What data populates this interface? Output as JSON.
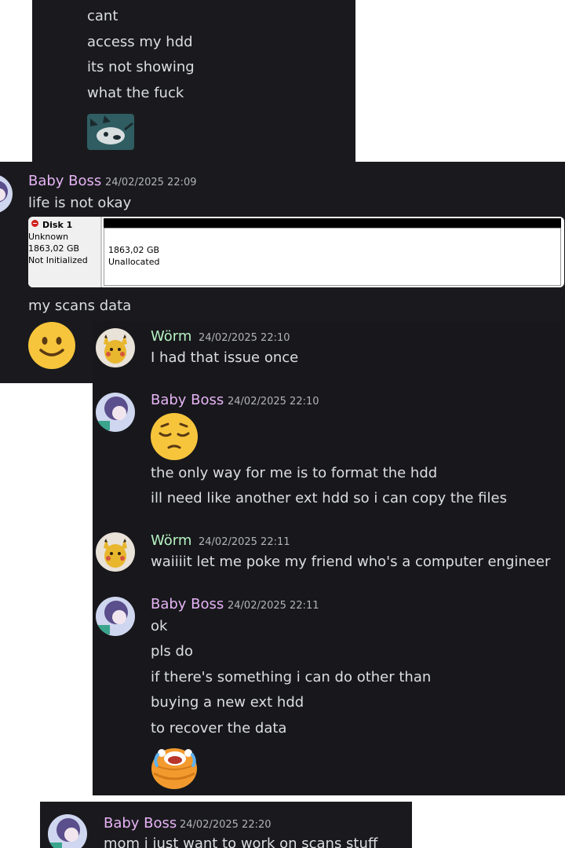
{
  "top_messages": [
    "cant",
    "access my hdd",
    "its not showing",
    "what the fuck"
  ],
  "baby_boss_1": {
    "username": "Baby Boss",
    "timestamp": "24/02/2025 22:09",
    "message_1": "life is not okay",
    "message_2": "my scans data"
  },
  "disk_screenshot": {
    "disk_label": "Disk 1",
    "type": "Unknown",
    "size": "1863,02 GB",
    "status": "Not Initialized",
    "region_size": "1863,02 GB",
    "region_status": "Unallocated"
  },
  "worm_1": {
    "username": "Wörm",
    "timestamp": "24/02/2025 22:10",
    "message": "I had that issue once"
  },
  "baby_boss_2": {
    "username": "Baby Boss",
    "timestamp": "24/02/2025 22:10",
    "messages": [
      "the only way for me is to format the hdd",
      "ill need like another ext hdd so i can copy the files"
    ]
  },
  "worm_2": {
    "username": "Wörm",
    "timestamp": "24/02/2025 22:11",
    "message": "waiiiit let me poke my friend who's a computer engineer"
  },
  "baby_boss_3": {
    "username": "Baby Boss",
    "timestamp": "24/02/2025 22:11",
    "messages": [
      "ok",
      "pls do",
      "if there's something i can do other than",
      "buying a new ext hdd",
      "to recover the data"
    ]
  },
  "baby_boss_4": {
    "username": "Baby Boss",
    "timestamp": "24/02/2025 22:20",
    "message": "mom i just want to work on scans stuff"
  },
  "colors": {
    "background": "#1a1a1e",
    "baby_boss_name": "#e6b3f5",
    "worm_name": "#b6f2c2",
    "text": "#dbdee1",
    "timestamp": "#b0b3b8"
  }
}
